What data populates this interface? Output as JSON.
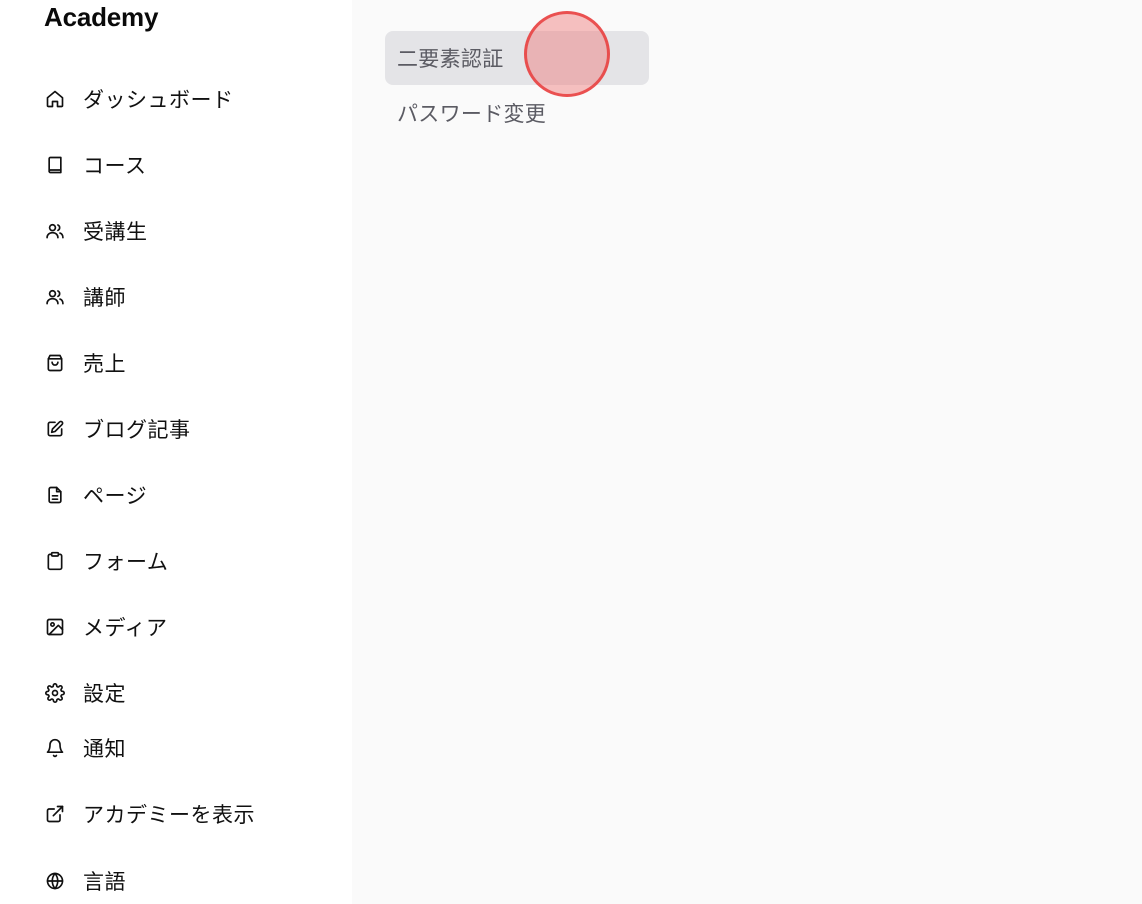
{
  "app": {
    "brand": "Academy"
  },
  "sidebar": {
    "items": [
      {
        "label": "ダッシュボード",
        "icon": "home-icon"
      },
      {
        "label": "コース",
        "icon": "book-icon"
      },
      {
        "label": "受講生",
        "icon": "users-icon"
      },
      {
        "label": "講師",
        "icon": "users-icon"
      },
      {
        "label": "売上",
        "icon": "shopping-bag-icon"
      },
      {
        "label": "ブログ記事",
        "icon": "edit-icon"
      },
      {
        "label": "ページ",
        "icon": "file-text-icon"
      },
      {
        "label": "フォーム",
        "icon": "clipboard-icon"
      },
      {
        "label": "メディア",
        "icon": "image-icon"
      },
      {
        "label": "設定",
        "icon": "gear-icon"
      },
      {
        "label": "通知",
        "icon": "bell-icon"
      },
      {
        "label": "アカデミーを表示",
        "icon": "external-link-icon"
      },
      {
        "label": "言語",
        "icon": "globe-icon"
      }
    ]
  },
  "main": {
    "submenu": [
      {
        "label": "二要素認証",
        "active": true
      },
      {
        "label": "パスワード変更",
        "active": false
      }
    ]
  },
  "colors": {
    "sidebar_bg": "#ffffff",
    "main_bg": "#fafafa",
    "active_item_bg": "#e4e4e7",
    "click_marker": "#e83c3c"
  }
}
